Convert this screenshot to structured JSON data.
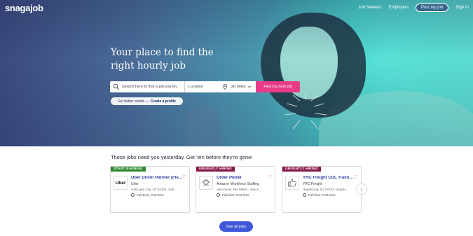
{
  "header": {
    "logo": "snagajob",
    "nav": {
      "job_seekers": "Job Seekers",
      "employers": "Employers",
      "post_job": "Post my job",
      "sign_in": "Sign In"
    }
  },
  "hero": {
    "headline_line1": "Your place to find the",
    "headline_line2": "right hourly job",
    "search": {
      "job_placeholder": "Search here to find a job you lov",
      "location_placeholder": "Location",
      "radius": "20 miles",
      "submit": "Find my next job"
    },
    "profile_cta": {
      "prefix": "Get better results —",
      "link": "Create a profile"
    }
  },
  "jobs": {
    "tagline": "These jobs need you yesterday. Get 'em before they're gone!",
    "cards": [
      {
        "badge": "START EARNING",
        "badge_color": "#2e8b2e",
        "logo": "Uber",
        "title": "Uber Driver Partner (Fle...",
        "company": "Uber",
        "location": "Salt Lake City, UT 84101, Salt...",
        "type": "Full-time, Part-time"
      },
      {
        "badge": "URGENTLY HIRING",
        "badge_color": "#8a1a4a",
        "logo": "headset-logo-icon",
        "title": "Order Picker",
        "company": "Amazon Workforce Staffing",
        "location": "Vancouver, WA 98661, Vanco...",
        "type": "Full-time, Part-time"
      },
      {
        "badge": "URGENTLY HIRING",
        "badge_color": "#8a1a4a",
        "logo": "thumbs-up-logo-icon",
        "title": "YRC Freight CDL Trainin...",
        "company": "YRC Freight",
        "location": "Hopatcong, NJ 07843, Hopatc...",
        "type": "Full-time, Part-time"
      }
    ],
    "next_arrow": "›",
    "see_all": "See all jobs"
  },
  "colors": {
    "accent_pink": "#e83c88",
    "accent_blue": "#3f57d8",
    "job_title": "#2b3aa0"
  }
}
